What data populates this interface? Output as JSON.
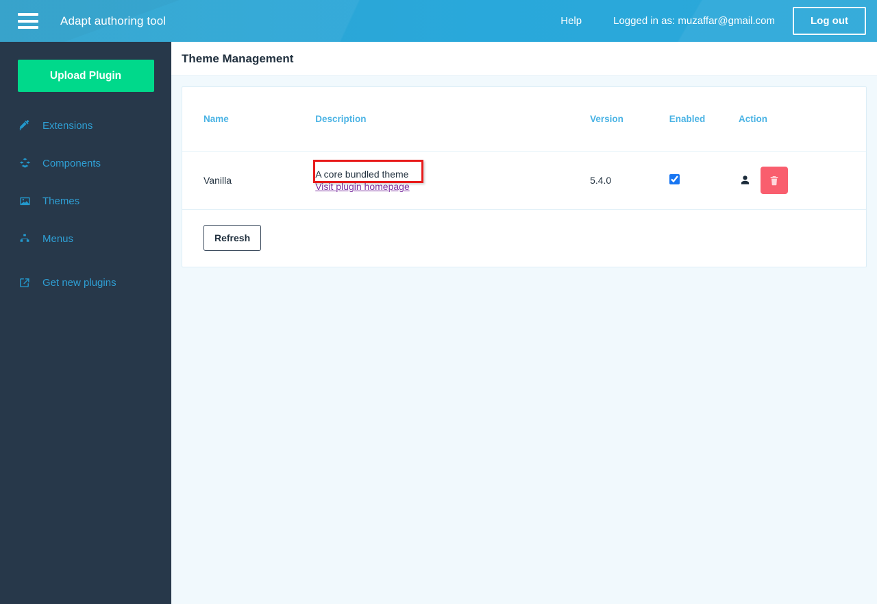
{
  "header": {
    "menu_icon": "hamburger-menu-icon",
    "app_title": "Adapt authoring tool",
    "help_label": "Help",
    "logged_in_text": "Logged in as: muzaffar@gmail.com",
    "logout_label": "Log out",
    "background_color": "#2ba5d4"
  },
  "sidebar": {
    "background_color": "#27384a",
    "upload_label": "Upload Plugin",
    "upload_color": "#00d98b",
    "accent_color": "#2f9fd4",
    "items": [
      {
        "label": "Extensions",
        "icon": "plug-icon"
      },
      {
        "label": "Components",
        "icon": "cubes-icon"
      },
      {
        "label": "Themes",
        "icon": "image-icon"
      },
      {
        "label": "Menus",
        "icon": "sitemap-icon"
      },
      {
        "label": "Get new plugins",
        "icon": "external-link-icon"
      }
    ]
  },
  "main": {
    "page_title": "Theme Management",
    "background_color": "#f1f9fd",
    "table": {
      "header_color": "#4ab3e4",
      "columns": [
        "Name",
        "Description",
        "Version",
        "Enabled",
        "Action"
      ],
      "rows": [
        {
          "name": "Vanilla",
          "description": "A core bundled theme",
          "link_label": "Visit plugin homepage",
          "link_color": "#7b2fa0",
          "version": "5.4.0",
          "enabled": true,
          "user_icon": "user-icon",
          "delete_icon": "trash-icon",
          "delete_color": "#f95e6e"
        }
      ]
    },
    "refresh_label": "Refresh"
  },
  "annotation": {
    "highlight_target": "Visit plugin homepage",
    "highlight_color": "#e81b1b"
  }
}
